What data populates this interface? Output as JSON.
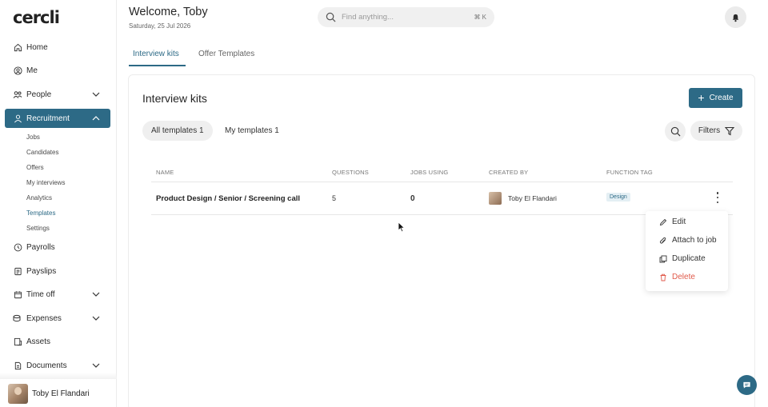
{
  "app": {
    "logo": "cercli"
  },
  "sidebar": {
    "items": [
      {
        "label": "Home",
        "icon": "home-icon"
      },
      {
        "label": "Me",
        "icon": "user-circle-icon"
      },
      {
        "label": "People",
        "icon": "people-icon",
        "expandable": true
      },
      {
        "label": "Recruitment",
        "icon": "recruitment-icon",
        "expandable": true,
        "expanded": true,
        "active": true
      },
      {
        "label": "Payrolls",
        "icon": "payroll-icon"
      },
      {
        "label": "Payslips",
        "icon": "payslip-icon"
      },
      {
        "label": "Time off",
        "icon": "calendar-icon",
        "expandable": true
      },
      {
        "label": "Expenses",
        "icon": "expenses-icon",
        "expandable": true
      },
      {
        "label": "Assets",
        "icon": "assets-icon"
      },
      {
        "label": "Documents",
        "icon": "documents-icon",
        "expandable": true
      }
    ],
    "recruitment_sub": [
      "Jobs",
      "Candidates",
      "Offers",
      "My interviews",
      "Analytics",
      "Templates",
      "Settings"
    ],
    "current_sub": "Templates",
    "user": {
      "name": "Toby El Flandari"
    }
  },
  "header": {
    "title": "Welcome, Toby",
    "date": "Saturday, 25 Jul 2026",
    "search_placeholder": "Find anything...",
    "search_shortcut": "⌘ K"
  },
  "tabs": [
    {
      "label": "Interview kits",
      "active": true
    },
    {
      "label": "Offer Templates",
      "active": false
    }
  ],
  "main": {
    "title": "Interview kits",
    "create_label": "Create",
    "filter_pills": [
      "All templates 1",
      "My templates 1"
    ],
    "filters_label": "Filters",
    "columns": [
      "NAME",
      "QUESTIONS",
      "JOBS USING",
      "CREATED BY",
      "FUNCTION TAG"
    ],
    "rows": [
      {
        "name": "Product Design / Senior / Screening call",
        "questions": "5",
        "jobs_using": "0",
        "created_by": "Toby El Flandari",
        "function_tag": "Design"
      }
    ]
  },
  "context_menu": {
    "items": [
      {
        "label": "Edit",
        "icon": "pencil-icon"
      },
      {
        "label": "Attach to job",
        "icon": "paperclip-icon"
      },
      {
        "label": "Duplicate",
        "icon": "duplicate-icon"
      },
      {
        "label": "Delete",
        "icon": "trash-icon",
        "danger": true
      }
    ]
  },
  "colors": {
    "accent": "#2d6a86",
    "danger": "#e05a4b",
    "tag_bg": "#e4eff4"
  }
}
